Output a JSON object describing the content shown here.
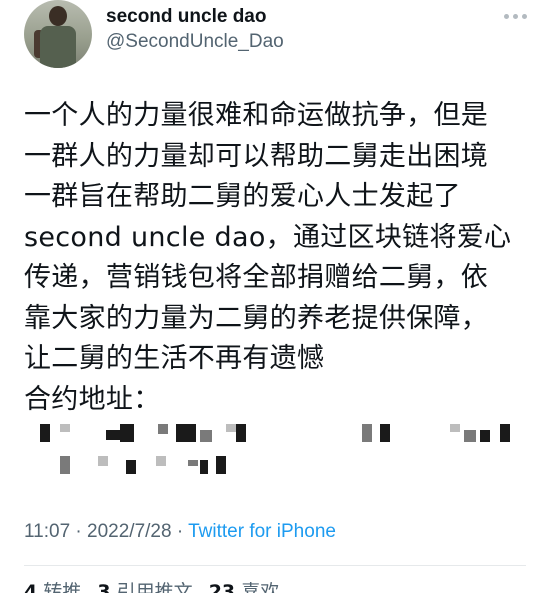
{
  "user": {
    "display_name": "second uncle dao",
    "handle": "@SecondUncle_Dao"
  },
  "tweet": {
    "lines": [
      "一个人的力量很难和命运做抗争，但是",
      "一群人的力量却可以帮助二舅走出困境",
      "一群旨在帮助二舅的爱心人士发起了",
      "second uncle dao，通过区块链将爱心",
      "传递，营销钱包将全部捐赠给二舅，依",
      "靠大家的力量为二舅的养老提供保障，",
      "让二舅的生活不再有遗憾",
      "合约地址："
    ],
    "address_redacted": true
  },
  "meta": {
    "time": "11:07",
    "sep1": " · ",
    "date": "2022/7/28",
    "sep2": " · ",
    "source": "Twitter for iPhone"
  },
  "stats": {
    "retweets_count": "4",
    "retweets_label": "转推",
    "quotes_count": "3",
    "quotes_label": "引用推文",
    "likes_count": "23",
    "likes_label": "喜欢"
  },
  "icons": {
    "more": "more-horizontal-icon"
  }
}
